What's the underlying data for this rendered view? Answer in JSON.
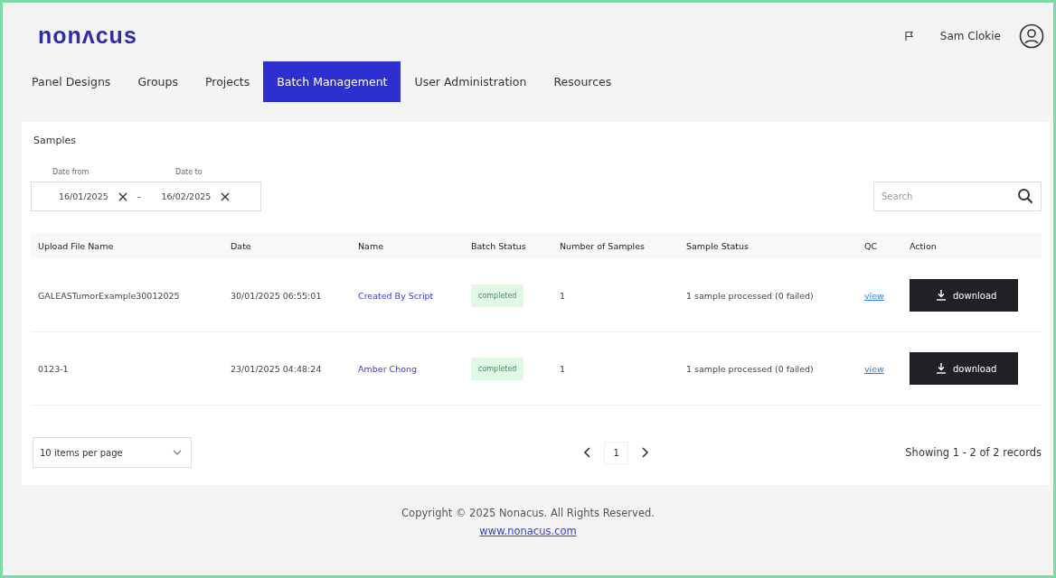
{
  "header": {
    "logo": "nonʌcus",
    "user_name": "Sam Clokie"
  },
  "tabs": [
    {
      "label": "Panel Designs",
      "selected": false
    },
    {
      "label": "Groups",
      "selected": false
    },
    {
      "label": "Projects",
      "selected": false
    },
    {
      "label": "Batch Management",
      "selected": true
    },
    {
      "label": "User Administration",
      "selected": false
    },
    {
      "label": "Resources",
      "selected": false
    }
  ],
  "panel": {
    "title": "Samples",
    "date_from": {
      "label": "Date from",
      "value": "16/01/2025"
    },
    "separator": "–",
    "date_to": {
      "label": "Date to",
      "value": "16/02/2025"
    },
    "search": {
      "placeholder": "Search"
    }
  },
  "table": {
    "columns": [
      "Upload File Name",
      "Date",
      "Name",
      "Batch Status",
      "Number of Samples",
      "Sample Status",
      "QC",
      "Action"
    ],
    "rows": [
      {
        "file": "GALEASTumorExample30012025",
        "date": "30/01/2025 06:55:01",
        "name": "Created By Script",
        "batch_status": "completed",
        "count": "1",
        "sample_status": "1 sample processed (0 failed)",
        "qc": "view",
        "action": "download"
      },
      {
        "file": "0123-1",
        "date": "23/01/2025 04:48:24",
        "name": "Amber Chong",
        "batch_status": "completed",
        "count": "1",
        "sample_status": "1 sample processed (0 failed)",
        "qc": "view",
        "action": "download"
      }
    ]
  },
  "pagination": {
    "page_size": "10 items per page",
    "page": "1",
    "summary": "Showing 1 - 2 of 2 records"
  },
  "footer": {
    "copyright": "Copyright © 2025 Nonacus. All Rights Reserved.",
    "link": "www.nonacus.com"
  }
}
